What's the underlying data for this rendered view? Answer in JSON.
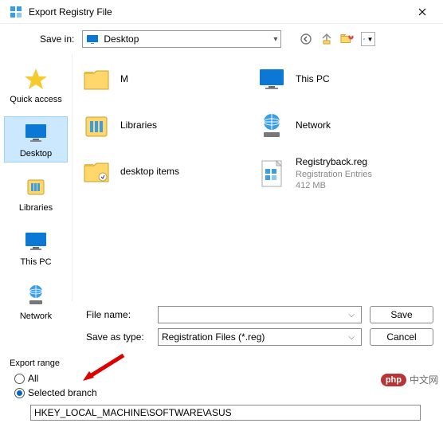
{
  "window": {
    "title": "Export Registry File"
  },
  "toolbar": {
    "save_in_label": "Save in:",
    "location": "Desktop"
  },
  "places": [
    {
      "id": "quick-access",
      "label": "Quick access"
    },
    {
      "id": "desktop",
      "label": "Desktop"
    },
    {
      "id": "libraries",
      "label": "Libraries"
    },
    {
      "id": "this-pc",
      "label": "This PC"
    },
    {
      "id": "network",
      "label": "Network"
    }
  ],
  "items": {
    "col1": [
      {
        "name": "M",
        "kind": "folder"
      },
      {
        "name": "Libraries",
        "kind": "libraries"
      },
      {
        "name": "desktop items",
        "kind": "folder"
      }
    ],
    "col2": [
      {
        "name": "This PC",
        "kind": "pc"
      },
      {
        "name": "Network",
        "kind": "network"
      },
      {
        "name": "Registryback.reg",
        "kind": "regfile",
        "sub1": "Registration Entries",
        "sub2": "412 MB"
      }
    ]
  },
  "fields": {
    "file_name_label": "File name:",
    "file_name_value": "",
    "save_as_type_label": "Save as type:",
    "save_as_type_value": "Registration Files (*.reg)",
    "save_button": "Save",
    "cancel_button": "Cancel"
  },
  "export_range": {
    "group_label": "Export range",
    "all_label": "All",
    "selected_branch_label": "Selected branch",
    "selected": "selected_branch",
    "branch_value": "HKEY_LOCAL_MACHINE\\SOFTWARE\\ASUS"
  },
  "watermark": {
    "badge": "php",
    "text": "中文网"
  }
}
